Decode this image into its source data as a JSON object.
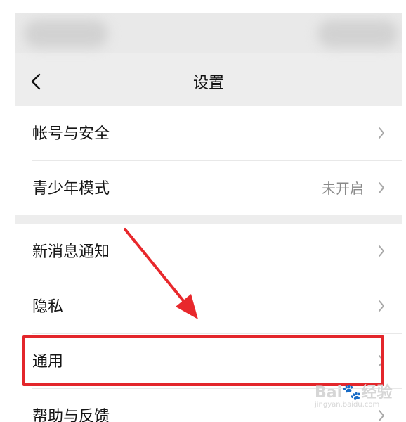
{
  "nav": {
    "title": "设置"
  },
  "groups": [
    {
      "items": [
        {
          "label": "帐号与安全",
          "value": ""
        },
        {
          "label": "青少年模式",
          "value": "未开启"
        }
      ]
    },
    {
      "items": [
        {
          "label": "新消息通知",
          "value": ""
        },
        {
          "label": "隐私",
          "value": ""
        },
        {
          "label": "通用",
          "value": ""
        },
        {
          "label": "帮助与反馈",
          "value": ""
        }
      ]
    }
  ],
  "watermark": {
    "main": "Bai🐾经验",
    "sub": "jingyan.baidu.com"
  },
  "colors": {
    "highlight": "#e3262b",
    "background": "#ededed"
  }
}
